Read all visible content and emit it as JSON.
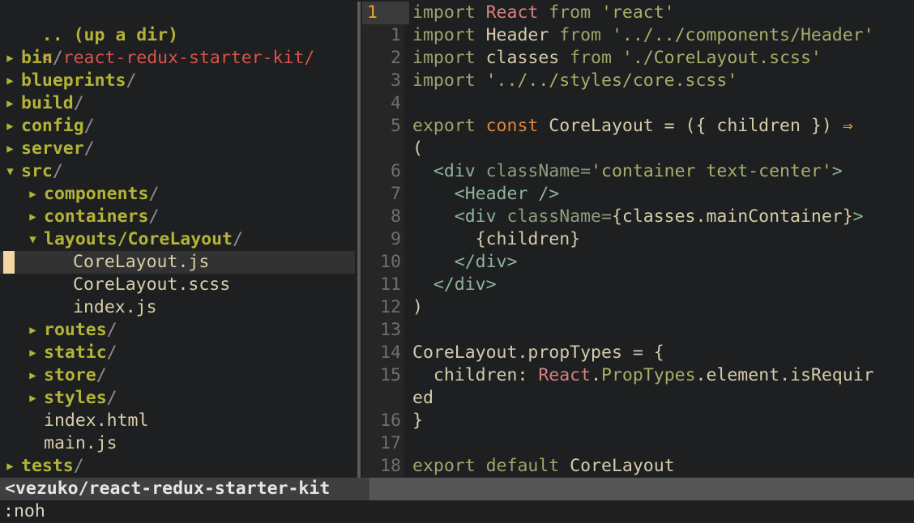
{
  "tree": {
    "updir_label": ".. (up a dir)",
    "root_path": "</react-redux-starter-kit/",
    "items": [
      {
        "name": "bin",
        "kind": "dir",
        "expanded": false,
        "depth": 0
      },
      {
        "name": "blueprints",
        "kind": "dir",
        "expanded": false,
        "depth": 0
      },
      {
        "name": "build",
        "kind": "dir",
        "expanded": false,
        "depth": 0
      },
      {
        "name": "config",
        "kind": "dir",
        "expanded": false,
        "depth": 0
      },
      {
        "name": "server",
        "kind": "dir",
        "expanded": false,
        "depth": 0
      },
      {
        "name": "src",
        "kind": "dir",
        "expanded": true,
        "depth": 0
      },
      {
        "name": "components",
        "kind": "dir",
        "expanded": false,
        "depth": 1
      },
      {
        "name": "containers",
        "kind": "dir",
        "expanded": false,
        "depth": 1
      },
      {
        "name": "layouts/CoreLayout",
        "kind": "dir",
        "expanded": true,
        "depth": 1
      },
      {
        "name": "CoreLayout.js",
        "kind": "file",
        "depth": 2,
        "selected": true
      },
      {
        "name": "CoreLayout.scss",
        "kind": "file",
        "depth": 2
      },
      {
        "name": "index.js",
        "kind": "file",
        "depth": 2
      },
      {
        "name": "routes",
        "kind": "dir",
        "expanded": false,
        "depth": 1
      },
      {
        "name": "static",
        "kind": "dir",
        "expanded": false,
        "depth": 1
      },
      {
        "name": "store",
        "kind": "dir",
        "expanded": false,
        "depth": 1
      },
      {
        "name": "styles",
        "kind": "dir",
        "expanded": false,
        "depth": 1
      },
      {
        "name": "index.html",
        "kind": "file",
        "depth": 1
      },
      {
        "name": "main.js",
        "kind": "file",
        "depth": 1
      },
      {
        "name": "tests",
        "kind": "dir",
        "expanded": false,
        "depth": 0
      }
    ]
  },
  "editor": {
    "lines": [
      {
        "num": "1",
        "current": true,
        "tokens": [
          [
            "kw",
            "import "
          ],
          [
            "react",
            "React "
          ],
          [
            "kw",
            "from "
          ],
          [
            "str",
            "'react'"
          ]
        ]
      },
      {
        "num": "1",
        "tokens": [
          [
            "kw",
            "import "
          ],
          [
            "id",
            "Header "
          ],
          [
            "kw",
            "from "
          ],
          [
            "str",
            "'../../components/Header'"
          ]
        ]
      },
      {
        "num": "2",
        "tokens": [
          [
            "kw",
            "import "
          ],
          [
            "id",
            "classes "
          ],
          [
            "kw",
            "from "
          ],
          [
            "str",
            "'./CoreLayout.scss'"
          ]
        ]
      },
      {
        "num": "3",
        "tokens": [
          [
            "kw",
            "import "
          ],
          [
            "str",
            "'../../styles/core.scss'"
          ]
        ]
      },
      {
        "num": "4",
        "tokens": []
      },
      {
        "num": "5",
        "tokens": [
          [
            "kw",
            "export "
          ],
          [
            "kw-orange",
            "const "
          ],
          [
            "id",
            "CoreLayout = ({ children }) "
          ],
          [
            "arrowop",
            "⇒"
          ]
        ]
      },
      {
        "num": "",
        "tokens": [
          [
            "punct",
            "("
          ]
        ]
      },
      {
        "num": "6",
        "tokens": [
          [
            "tag",
            "  <div "
          ],
          [
            "attr",
            "className="
          ],
          [
            "str",
            "'container text-center'"
          ],
          [
            "tag",
            ">"
          ]
        ]
      },
      {
        "num": "7",
        "tokens": [
          [
            "tag",
            "    <Header />"
          ]
        ]
      },
      {
        "num": "8",
        "tokens": [
          [
            "tag",
            "    <div "
          ],
          [
            "attr",
            "className="
          ],
          [
            "id",
            "{classes.mainContainer}"
          ],
          [
            "tag",
            ">"
          ]
        ]
      },
      {
        "num": "9",
        "tokens": [
          [
            "id",
            "      {children}"
          ]
        ]
      },
      {
        "num": "10",
        "tokens": [
          [
            "tag",
            "    </div>"
          ]
        ]
      },
      {
        "num": "11",
        "tokens": [
          [
            "tag",
            "  </div>"
          ]
        ]
      },
      {
        "num": "12",
        "tokens": [
          [
            "punct",
            ")"
          ]
        ]
      },
      {
        "num": "13",
        "tokens": []
      },
      {
        "num": "14",
        "tokens": [
          [
            "id",
            "CoreLayout.propTypes = {"
          ]
        ]
      },
      {
        "num": "15",
        "tokens": [
          [
            "id",
            "  children: "
          ],
          [
            "react",
            "React"
          ],
          [
            "id",
            "."
          ],
          [
            "proptypes",
            "PropTypes"
          ],
          [
            "id",
            ".element.isRequir"
          ]
        ]
      },
      {
        "num": "",
        "tokens": [
          [
            "id",
            "ed"
          ]
        ]
      },
      {
        "num": "16",
        "tokens": [
          [
            "id",
            "}"
          ]
        ]
      },
      {
        "num": "17",
        "tokens": []
      },
      {
        "num": "18",
        "tokens": [
          [
            "kw",
            "export "
          ],
          [
            "kw",
            "default "
          ],
          [
            "id",
            "CoreLayout"
          ]
        ]
      }
    ]
  },
  "statusline": {
    "left_text": "<vezuko/react-redux-starter-kit"
  },
  "cmdline": {
    "text": ":noh"
  }
}
